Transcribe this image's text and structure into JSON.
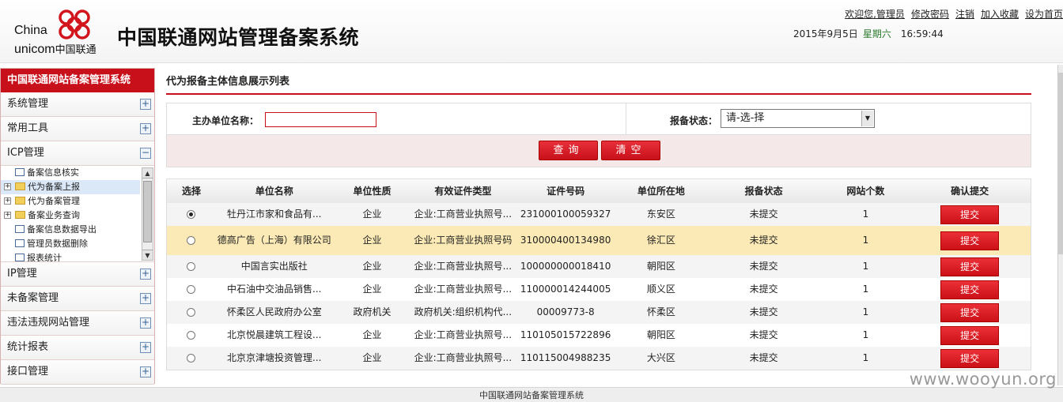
{
  "header": {
    "logo_en_1": "China",
    "logo_en_2": "unicom",
    "logo_cn": "中国联通",
    "title": "中国联通网站管理备案系统",
    "links": [
      "欢迎您,管理员",
      "修改密码",
      "注销",
      "加入收藏",
      "设为首页"
    ],
    "date": "2015年9月5日",
    "weekday": "星期六",
    "time": "16:59:44",
    "brand_color": "#c8101a"
  },
  "sidebar": {
    "title": "中国联通网站备案管理系统",
    "items_top": [
      {
        "label": "系统管理",
        "toggle": "+"
      },
      {
        "label": "常用工具",
        "toggle": "+"
      },
      {
        "label": "ICP管理",
        "toggle": "−"
      }
    ],
    "tree": [
      {
        "label": "备案信息核实",
        "icon": "doc-icon",
        "expand": ""
      },
      {
        "label": "代为备案上报",
        "icon": "folder-icon",
        "expand": "+",
        "selected": true
      },
      {
        "label": "代为备案管理",
        "icon": "folder-icon",
        "expand": "+"
      },
      {
        "label": "备案业务查询",
        "icon": "folder-icon",
        "expand": "+"
      },
      {
        "label": "备案信息数据导出",
        "icon": "doc-icon",
        "expand": ""
      },
      {
        "label": "管理员数据删除",
        "icon": "doc-icon",
        "expand": ""
      },
      {
        "label": "报表统计",
        "icon": "doc-icon",
        "expand": ""
      }
    ],
    "items_bottom": [
      {
        "label": "IP管理",
        "toggle": "+"
      },
      {
        "label": "未备案管理",
        "toggle": "+"
      },
      {
        "label": "违法违规网站管理",
        "toggle": "+"
      },
      {
        "label": "统计报表",
        "toggle": "+"
      },
      {
        "label": "接口管理",
        "toggle": "+"
      }
    ]
  },
  "main": {
    "title": "代为报备主体信息展示列表",
    "search": {
      "name_label": "主办单位名称：",
      "name_value": "",
      "status_label": "报备状态：",
      "status_selected": "请-选-择",
      "query_button": "查询",
      "clear_button": "清空"
    },
    "table": {
      "columns": [
        "选择",
        "单位名称",
        "单位性质",
        "有效证件类型",
        "证件号码",
        "单位所在地",
        "报备状态",
        "网站个数",
        "确认提交"
      ],
      "rows": [
        {
          "selected": true,
          "name": "牡丹江市家和食品有...",
          "nature": "企业",
          "cert_type": "企业:工商营业执照号...",
          "cert_no": "231000100059327",
          "location": "东安区",
          "status": "未提交",
          "sites": "1",
          "action": "提交"
        },
        {
          "selected": false,
          "name": "德高广告（上海）有限公司",
          "nature": "企业",
          "cert_type": "企业:工商营业执照号码",
          "cert_no": "310000400134980",
          "location": "徐汇区",
          "status": "未提交",
          "sites": "1",
          "action": "提交",
          "highlight": true
        },
        {
          "selected": false,
          "name": "中国言实出版社",
          "nature": "企业",
          "cert_type": "企业:工商营业执照号...",
          "cert_no": "100000000018410",
          "location": "朝阳区",
          "status": "未提交",
          "sites": "1",
          "action": "提交"
        },
        {
          "selected": false,
          "name": "中石油中交油品销售...",
          "nature": "企业",
          "cert_type": "企业:工商营业执照号...",
          "cert_no": "110000014244005",
          "location": "顺义区",
          "status": "未提交",
          "sites": "1",
          "action": "提交"
        },
        {
          "selected": false,
          "name": "怀柔区人民政府办公室",
          "nature": "政府机关",
          "cert_type": "政府机关:组织机构代...",
          "cert_no": "00009773-8",
          "location": "怀柔区",
          "status": "未提交",
          "sites": "1",
          "action": "提交"
        },
        {
          "selected": false,
          "name": "北京悦晨建筑工程设...",
          "nature": "企业",
          "cert_type": "企业:工商营业执照号...",
          "cert_no": "110105015722896",
          "location": "朝阳区",
          "status": "未提交",
          "sites": "1",
          "action": "提交"
        },
        {
          "selected": false,
          "name": "北京京津塘投资管理...",
          "nature": "企业",
          "cert_type": "企业:工商营业执照号...",
          "cert_no": "110115004988235",
          "location": "大兴区",
          "status": "未提交",
          "sites": "1",
          "action": "提交"
        }
      ]
    }
  },
  "footer": {
    "text": "中国联通网站备案管理系统"
  },
  "watermark": "www.wooyun.org"
}
